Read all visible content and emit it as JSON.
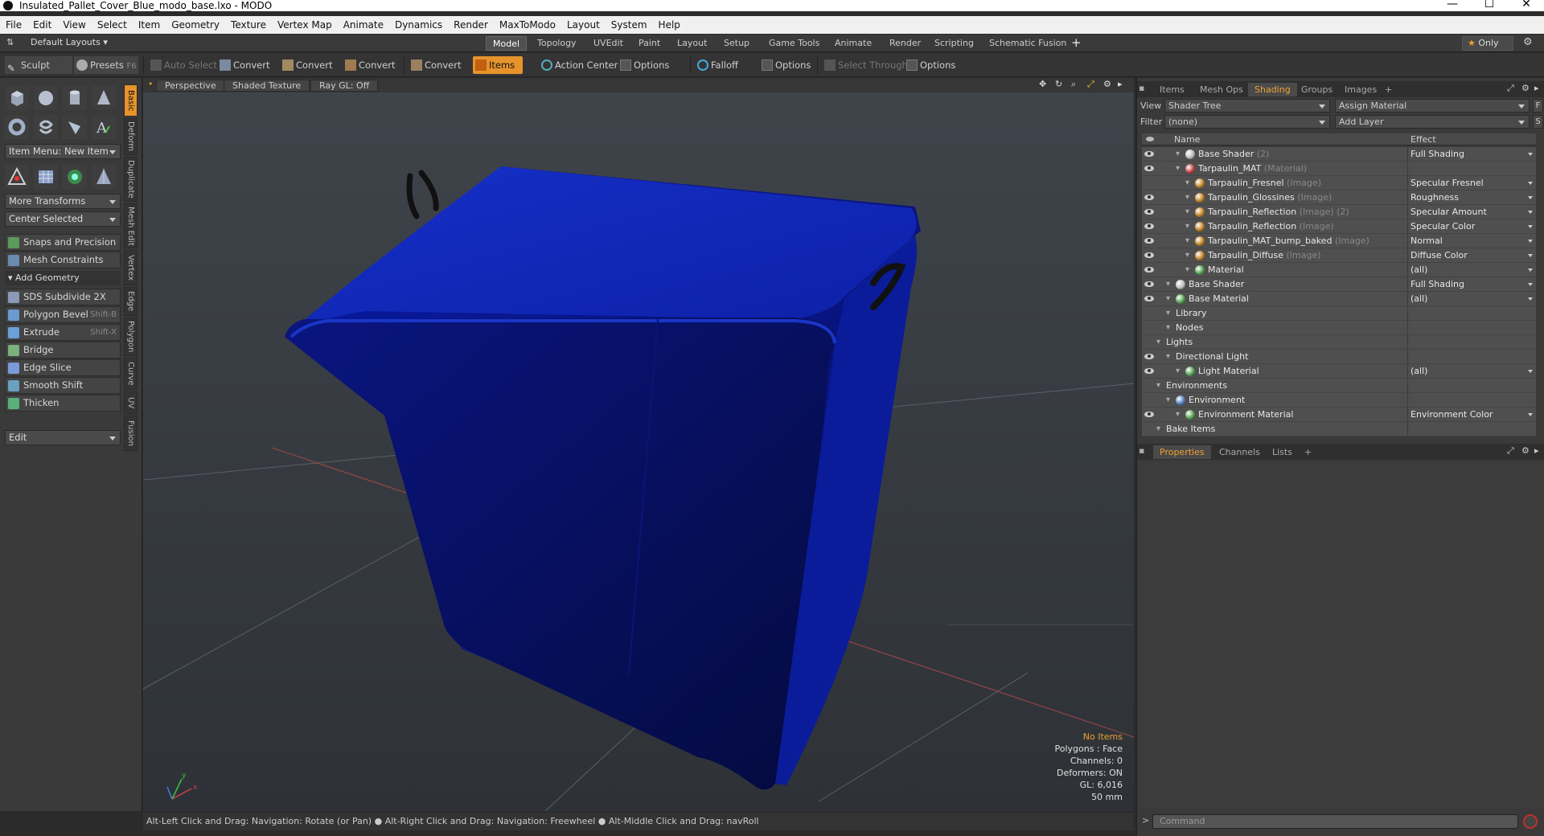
{
  "window": {
    "title": "Insulated_Pallet_Cover_Blue_modo_base.lxo - MODO",
    "minimize": "—",
    "maximize": "☐",
    "close": "✕"
  },
  "menu": [
    "File",
    "Edit",
    "View",
    "Select",
    "Item",
    "Geometry",
    "Texture",
    "Vertex Map",
    "Animate",
    "Dynamics",
    "Render",
    "MaxToModo",
    "Layout",
    "System",
    "Help"
  ],
  "layoutbar": {
    "layouts_label": "Default Layouts",
    "tabs": [
      "Model",
      "Topology",
      "UVEdit",
      "Paint",
      "Layout",
      "Setup",
      "Game Tools",
      "Animate",
      "Render",
      "Scripting",
      "Schematic Fusion"
    ],
    "active_tab": "Model",
    "add": "+",
    "only": "Only"
  },
  "toolbar": {
    "sculpt": "Sculpt",
    "presets": "Presets",
    "presets_key": "F6",
    "auto_select": "Auto Select",
    "convert1": "Convert",
    "convert2": "Convert",
    "convert3": "Convert",
    "convert4": "Convert",
    "items": "Items",
    "action_center": "Action Center",
    "options1": "Options",
    "falloff": "Falloff",
    "options2": "Options",
    "select_through": "Select Through",
    "options3": "Options"
  },
  "leftpanel": {
    "item_menu": "Item Menu: New Item",
    "more_transforms": "More Transforms",
    "center_selected": "Center Selected",
    "snaps": "Snaps and Precision",
    "mesh_constraints": "Mesh Constraints",
    "add_geometry": "Add Geometry",
    "tools": [
      {
        "label": "SDS Subdivide 2X",
        "key": ""
      },
      {
        "label": "Polygon Bevel",
        "key": "Shift-B"
      },
      {
        "label": "Extrude",
        "key": "Shift-X"
      },
      {
        "label": "Bridge",
        "key": ""
      },
      {
        "label": "Edge Slice",
        "key": ""
      },
      {
        "label": "Smooth Shift",
        "key": ""
      },
      {
        "label": "Thicken",
        "key": ""
      }
    ],
    "edit": "Edit",
    "sidetabs": [
      "Basic",
      "Deform",
      "Duplicate",
      "Mesh Edit",
      "Vertex",
      "Edge",
      "Polygon",
      "Curve",
      "UV",
      "Fusion"
    ]
  },
  "viewport": {
    "view": "Perspective",
    "shading": "Shaded Texture",
    "raygl": "Ray GL: Off",
    "stats": {
      "items": "No Items",
      "polygons": "Polygons : Face",
      "channels": "Channels: 0",
      "deformers": "Deformers: ON",
      "gl": "GL: 6,016",
      "lens": "50 mm"
    }
  },
  "statusbar": "Alt-Left Click and Drag: Navigation: Rotate (or Pan) ● Alt-Right Click and Drag: Navigation: Freewheel ● Alt-Middle Click and Drag: navRoll",
  "rightpanel": {
    "tabs": [
      "Items",
      "Mesh Ops",
      "Shading",
      "Groups",
      "Images",
      "+"
    ],
    "active_tab": "Shading",
    "view_label": "View",
    "view_value": "Shader Tree",
    "assign_material": "Assign Material",
    "assign_key": "F",
    "filter_label": "Filter",
    "filter_value": "(none)",
    "add_layer": "Add Layer",
    "add_key": "S",
    "col_name": "Name",
    "col_effect": "Effect",
    "tree": [
      {
        "name": "Base Shader",
        "suffix": "(2)",
        "effect": "Full Shading",
        "indent": 2,
        "ball": "#bbbbbb",
        "eye": true
      },
      {
        "name": "Tarpaulin_MAT",
        "suffix": "(Material)",
        "effect": "",
        "indent": 2,
        "ball": "#c04040",
        "eye": true
      },
      {
        "name": "Tarpaulin_Fresnel",
        "suffix": "(Image)",
        "effect": "Specular Fresnel",
        "indent": 3,
        "ball": "#c08020",
        "eye": false
      },
      {
        "name": "Tarpaulin_Glossines",
        "suffix": "(Image)",
        "effect": "Roughness",
        "indent": 3,
        "ball": "#c08020",
        "eye": true
      },
      {
        "name": "Tarpaulin_Reflection",
        "suffix": "(Image) (2)",
        "effect": "Specular Amount",
        "indent": 3,
        "ball": "#c08020",
        "eye": true
      },
      {
        "name": "Tarpaulin_Reflection",
        "suffix": "(Image)",
        "effect": "Specular Color",
        "indent": 3,
        "ball": "#c08020",
        "eye": true
      },
      {
        "name": "Tarpaulin_MAT_bump_baked",
        "suffix": "(Image)",
        "effect": "Normal",
        "indent": 3,
        "ball": "#c08020",
        "eye": true
      },
      {
        "name": "Tarpaulin_Diffuse",
        "suffix": "(Image)",
        "effect": "Diffuse Color",
        "indent": 3,
        "ball": "#c08020",
        "eye": true
      },
      {
        "name": "Material",
        "suffix": "",
        "effect": "(all)",
        "indent": 3,
        "ball": "#50a050",
        "eye": true
      },
      {
        "name": "Base Shader",
        "suffix": "",
        "effect": "Full Shading",
        "indent": 1,
        "ball": "#bbbbbb",
        "eye": true
      },
      {
        "name": "Base Material",
        "suffix": "",
        "effect": "(all)",
        "indent": 1,
        "ball": "#50a050",
        "eye": true
      },
      {
        "name": "Library",
        "suffix": "",
        "effect": "",
        "indent": 1,
        "ball": "",
        "eye": false
      },
      {
        "name": "Nodes",
        "suffix": "",
        "effect": "",
        "indent": 1,
        "ball": "",
        "eye": false
      },
      {
        "name": "Lights",
        "suffix": "",
        "effect": "",
        "indent": 0,
        "ball": "",
        "eye": false
      },
      {
        "name": "Directional Light",
        "suffix": "",
        "effect": "",
        "indent": 1,
        "ball": "",
        "eye": true
      },
      {
        "name": "Light Material",
        "suffix": "",
        "effect": "(all)",
        "indent": 2,
        "ball": "#50a050",
        "eye": true
      },
      {
        "name": "Environments",
        "suffix": "",
        "effect": "",
        "indent": 0,
        "ball": "",
        "eye": false
      },
      {
        "name": "Environment",
        "suffix": "",
        "effect": "",
        "indent": 1,
        "ball": "#5080c0",
        "eye": false
      },
      {
        "name": "Environment Material",
        "suffix": "",
        "effect": "Environment Color",
        "indent": 2,
        "ball": "#50a050",
        "eye": true
      },
      {
        "name": "Bake Items",
        "suffix": "",
        "effect": "",
        "indent": 0,
        "ball": "",
        "eye": false
      }
    ],
    "prop_tabs": [
      "Properties",
      "Channels",
      "Lists",
      "+"
    ],
    "prop_active": "Properties",
    "command_prompt": ">",
    "command_placeholder": "Command"
  },
  "colors": {
    "accent": "#e6932c",
    "object": "#0a1a9e"
  }
}
